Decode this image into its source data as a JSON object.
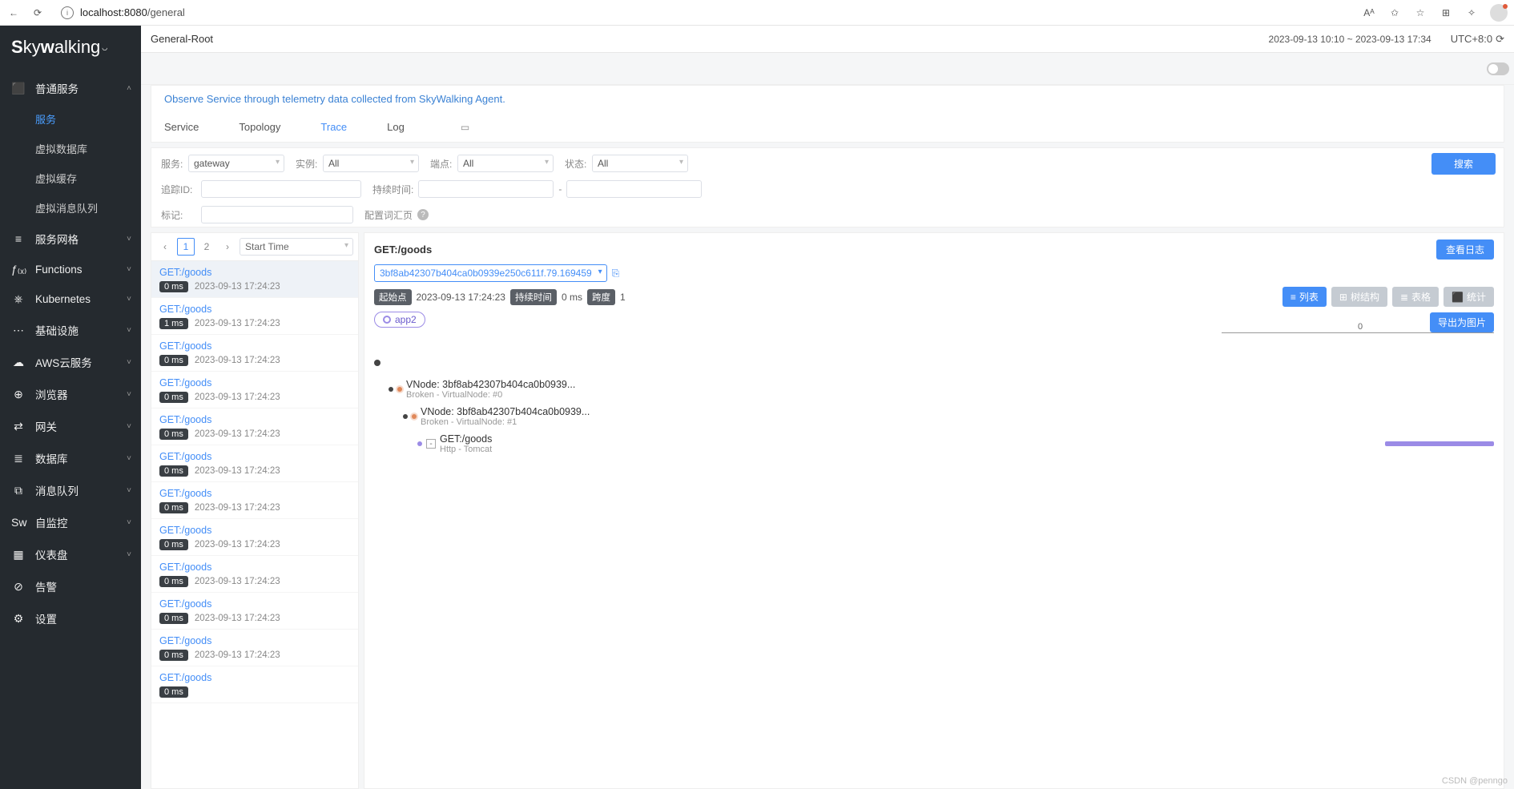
{
  "browser": {
    "url_host": "localhost:8080",
    "url_path": "/general"
  },
  "header": {
    "crumb": "General-Root",
    "time_range": "2023-09-13 10:10 ~ 2023-09-13 17:34",
    "tz": "UTC+8:0"
  },
  "desc": "Observe Service through telemetry data collected from SkyWalking Agent.",
  "sidebar": {
    "logo": "Skywalking",
    "groups": [
      {
        "label": "普通服务",
        "icon": "⬛",
        "expanded": true,
        "children": [
          {
            "label": "服务",
            "active": true
          },
          {
            "label": "虚拟数据库"
          },
          {
            "label": "虚拟缓存"
          },
          {
            "label": "虚拟消息队列"
          }
        ]
      },
      {
        "label": "服务网格",
        "icon": "≡"
      },
      {
        "label": "Functions",
        "icon": "ƒ₍ₓ₎"
      },
      {
        "label": "Kubernetes",
        "icon": "⎈"
      },
      {
        "label": "基础设施",
        "icon": "⋯"
      },
      {
        "label": "AWS云服务",
        "icon": "☁"
      },
      {
        "label": "浏览器",
        "icon": "⊕"
      },
      {
        "label": "网关",
        "icon": "⇄"
      },
      {
        "label": "数据库",
        "icon": "≣"
      },
      {
        "label": "消息队列",
        "icon": "⧉"
      },
      {
        "label": "自监控",
        "icon": "Sw"
      },
      {
        "label": "仪表盘",
        "icon": "▦"
      },
      {
        "label": "告警",
        "icon": "⊘"
      },
      {
        "label": "设置",
        "icon": "⚙"
      }
    ]
  },
  "tabs": {
    "items": [
      "Service",
      "Topology",
      "Trace",
      "Log"
    ],
    "active": 2
  },
  "filters": {
    "service_lbl": "服务:",
    "service_val": "gateway",
    "instance_lbl": "实例:",
    "instance_val": "All",
    "endpoint_lbl": "端点:",
    "endpoint_val": "All",
    "status_lbl": "状态:",
    "status_val": "All",
    "traceid_lbl": "追踪ID:",
    "duration_lbl": "持续时间:",
    "tag_lbl": "标记:",
    "keyword_lbl": "配置词汇页",
    "search_btn": "搜索"
  },
  "trace_list": {
    "pager": {
      "pages": [
        "1",
        "2"
      ],
      "active": 0
    },
    "sort": "Start Time",
    "items": [
      {
        "name": "GET:/goods",
        "dur": "0 ms",
        "ts": "2023-09-13 17:24:23",
        "active": true
      },
      {
        "name": "GET:/goods",
        "dur": "1 ms",
        "ts": "2023-09-13 17:24:23"
      },
      {
        "name": "GET:/goods",
        "dur": "0 ms",
        "ts": "2023-09-13 17:24:23"
      },
      {
        "name": "GET:/goods",
        "dur": "0 ms",
        "ts": "2023-09-13 17:24:23"
      },
      {
        "name": "GET:/goods",
        "dur": "0 ms",
        "ts": "2023-09-13 17:24:23"
      },
      {
        "name": "GET:/goods",
        "dur": "0 ms",
        "ts": "2023-09-13 17:24:23"
      },
      {
        "name": "GET:/goods",
        "dur": "0 ms",
        "ts": "2023-09-13 17:24:23"
      },
      {
        "name": "GET:/goods",
        "dur": "0 ms",
        "ts": "2023-09-13 17:24:23"
      },
      {
        "name": "GET:/goods",
        "dur": "0 ms",
        "ts": "2023-09-13 17:24:23"
      },
      {
        "name": "GET:/goods",
        "dur": "0 ms",
        "ts": "2023-09-13 17:24:23"
      },
      {
        "name": "GET:/goods",
        "dur": "0 ms",
        "ts": "2023-09-13 17:24:23"
      },
      {
        "name": "GET:/goods",
        "dur": "0 ms",
        "ts": ""
      }
    ]
  },
  "detail": {
    "title": "GET:/goods",
    "log_btn": "查看日志",
    "trace_id": "3bf8ab42307b404ca0b0939e250c611f.79.169459",
    "meta": {
      "start_lbl": "起始点",
      "start_val": "2023-09-13 17:24:23",
      "dur_lbl": "持续时间",
      "dur_val": "0 ms",
      "span_lbl": "跨度",
      "span_val": "1"
    },
    "views": {
      "list": "列表",
      "tree": "树结构",
      "table": "表格",
      "stat": "统计"
    },
    "app_tag": "app2",
    "export_btn": "导出为图片",
    "axis_tick": "0",
    "spans": [
      {
        "indent": 0,
        "t1": "",
        "t2": "",
        "root": true
      },
      {
        "indent": 1,
        "t1": "VNode: 3bf8ab42307b404ca0b0939...",
        "t2": "Broken - VirtualNode: #0"
      },
      {
        "indent": 2,
        "t1": "VNode: 3bf8ab42307b404ca0b0939...",
        "t2": "Broken - VirtualNode: #1"
      },
      {
        "indent": 3,
        "t1": "GET:/goods",
        "t2": "Http - Tomcat",
        "has_bar": true
      }
    ]
  },
  "watermark": "CSDN @penngo"
}
